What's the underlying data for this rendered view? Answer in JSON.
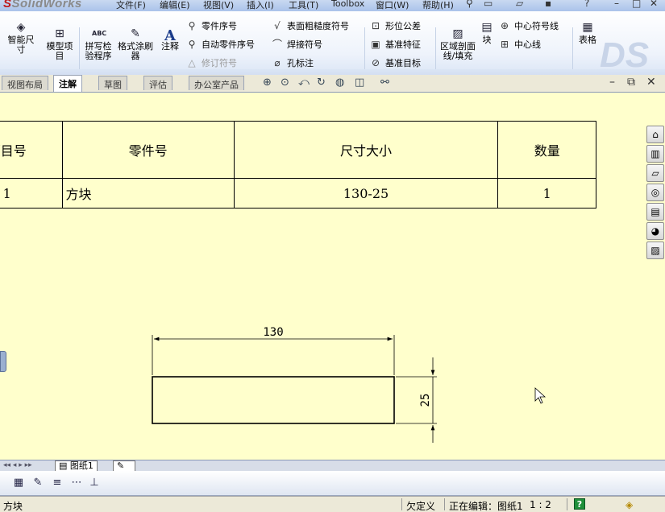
{
  "app": {
    "logo": "SolidWorks",
    "menu": [
      "文件(F)",
      "编辑(E)",
      "视图(V)",
      "插入(I)",
      "工具(T)",
      "Toolbox",
      "窗口(W)",
      "帮助(H)"
    ]
  },
  "ribbon": {
    "smart_dimension": "智能尺寸",
    "model_items": "模型项目",
    "spell_check": "拼写检验程序",
    "format_painter": "格式涂刷器",
    "note": "注释",
    "balloon": "零件序号",
    "auto_balloon": "自动零件序号",
    "revision_symbol": "修订符号",
    "surface_finish": "表面粗糙度符号",
    "weld_symbol": "焊接符号",
    "hole_callout": "孔标注",
    "geometric_tolerance": "形位公差",
    "datum_feature": "基准特征",
    "datum_target": "基准目标",
    "area_hatch": "区域剖面线/填充",
    "block": "块",
    "center_mark": "中心符号线",
    "centerline": "中心线",
    "table": "表格",
    "icons": {
      "smart_dimension": "smart-dimension-icon",
      "block": "block-icon",
      "table": "table-icon"
    }
  },
  "tabs": [
    "视图布局",
    "注解",
    "草图",
    "评估",
    "办公室产品"
  ],
  "active_tab": "注解",
  "bom": {
    "headers": [
      "项目号",
      "零件号",
      "尺寸大小",
      "数量"
    ],
    "rows": [
      [
        "1",
        "方块",
        "130-25",
        "1"
      ]
    ]
  },
  "drawing": {
    "width_dim": "130",
    "height_dim": "25"
  },
  "sheet_tab": "图纸1",
  "status": {
    "left": "方块",
    "definition": "欠定义",
    "editing": "正在编辑：图纸1",
    "scale": "1 : 2",
    "help": "?"
  }
}
